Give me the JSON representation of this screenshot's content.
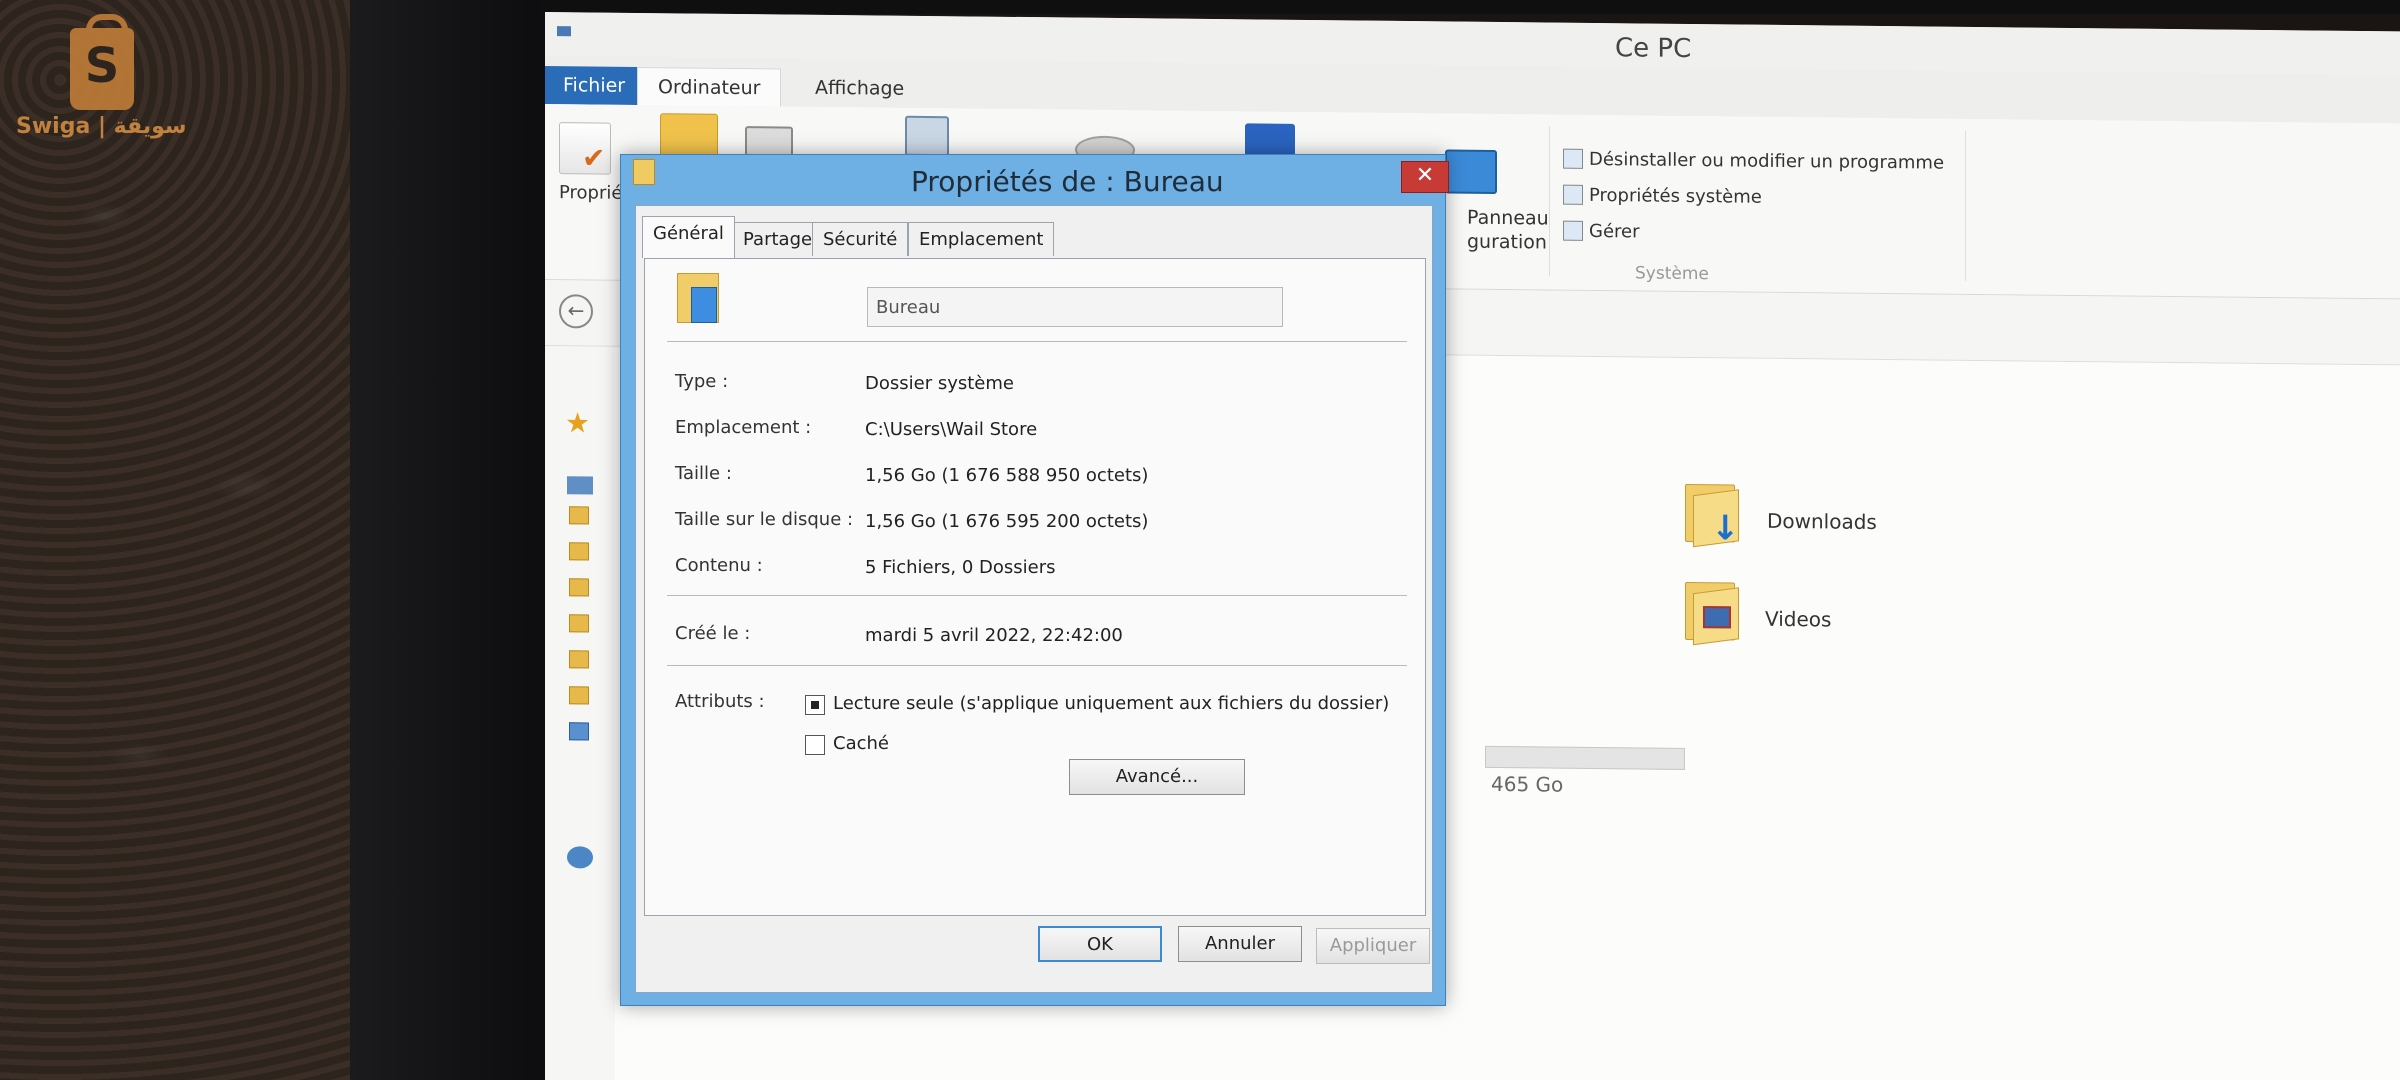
{
  "watermark": {
    "letter": "S",
    "text": "Swiga | سويقة"
  },
  "explorer": {
    "title": "Ce PC",
    "ribbon_tabs": [
      "Fichier",
      "Ordinateur",
      "Affichage"
    ],
    "ribbon": {
      "proprietes_label": "Propriét",
      "panneau_label_1": "Panneau",
      "panneau_label_2": "guration",
      "desinstaller": "Désinstaller ou modifier un programme",
      "proprietes_systeme": "Propriétés système",
      "gerer": "Gérer",
      "group_label": "Système"
    },
    "folders": [
      {
        "name": "Downloads",
        "icon": "downloads-folder-icon"
      },
      {
        "name": "Videos",
        "icon": "videos-folder-icon"
      }
    ],
    "drive_capacity": "465 Go"
  },
  "dialog": {
    "title": "Propriétés de : Bureau",
    "tabs": [
      "Général",
      "Partage",
      "Sécurité",
      "Emplacement"
    ],
    "name_value": "Bureau",
    "properties": [
      {
        "label": "Type :",
        "value": "Dossier système"
      },
      {
        "label": "Emplacement :",
        "value": "C:\\Users\\Wail Store"
      },
      {
        "label": "Taille :",
        "value": "1,56 Go (1 676 588 950 octets)"
      },
      {
        "label": "Taille sur le disque :",
        "value": "1,56 Go (1 676 595 200 octets)"
      },
      {
        "label": "Contenu :",
        "value": "5 Fichiers, 0 Dossiers"
      }
    ],
    "created": {
      "label": "Créé le :",
      "value": "mardi 5 avril 2022, 22:42:00"
    },
    "attributes": {
      "label": "Attributs :",
      "readonly_label": "Lecture seule (s'applique uniquement aux fichiers du dossier)",
      "readonly_checked": true,
      "hidden_label": "Caché",
      "hidden_checked": false,
      "advanced_button": "Avancé..."
    },
    "buttons": {
      "ok": "OK",
      "cancel": "Annuler",
      "apply": "Appliquer"
    },
    "colors": {
      "frame": "#6fb0e4",
      "close": "#c73a36",
      "accent": "#2b6cb8"
    }
  }
}
